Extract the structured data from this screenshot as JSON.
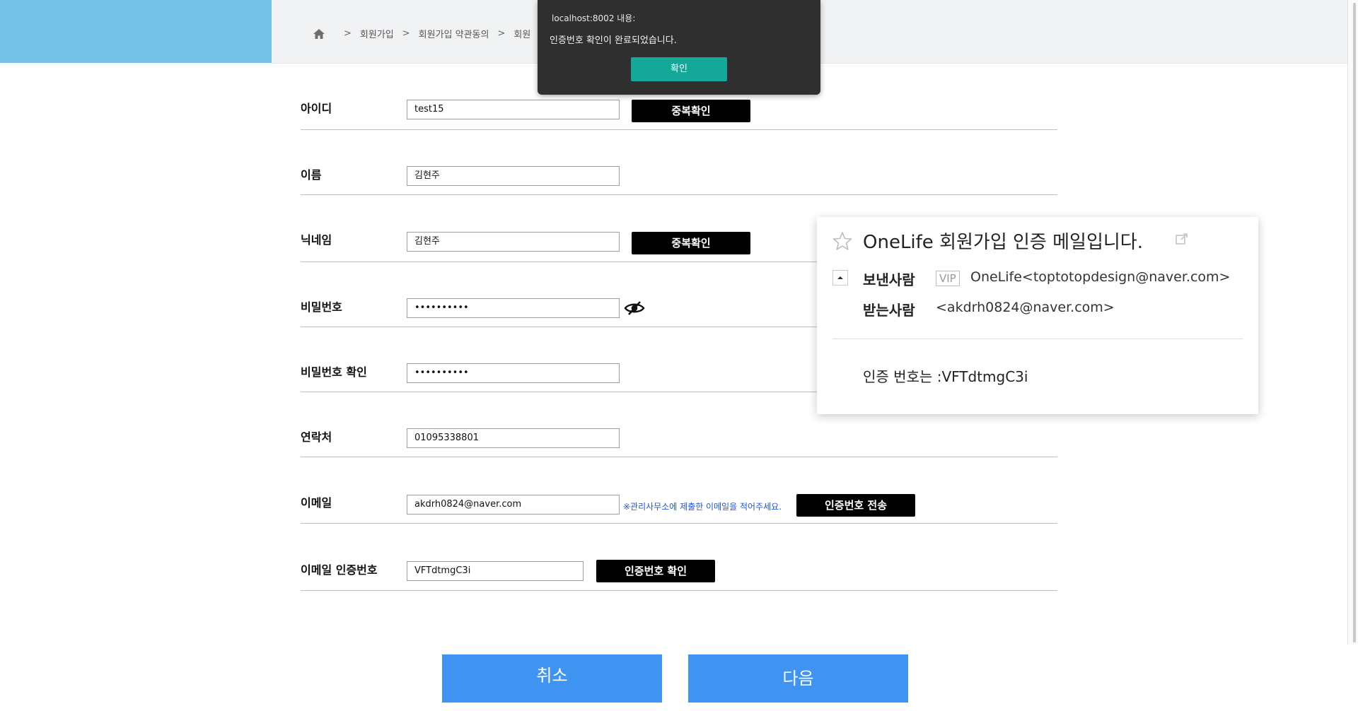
{
  "breadcrumb": {
    "items": [
      "회원가입",
      "회원가입 약관동의",
      "회원"
    ],
    "separator": ">"
  },
  "alert": {
    "origin": "localhost:8002 내용:",
    "message": "인증번호 확인이 완료되었습니다.",
    "ok_label": "확인"
  },
  "form": {
    "id": {
      "label": "아이디",
      "value": "test15",
      "button": "중복확인"
    },
    "name": {
      "label": "이름",
      "value": "김현주"
    },
    "nickname": {
      "label": "닉네임",
      "value": "김현주",
      "button": "중복확인"
    },
    "password": {
      "label": "비밀번호",
      "value": "••••••••••"
    },
    "password_confirm": {
      "label": "비밀번호 확인",
      "value": "••••••••••"
    },
    "phone": {
      "label": "연락처",
      "value": "01095338801"
    },
    "email": {
      "label": "이메일",
      "value": "akdrh0824@naver.com",
      "hint": "※관리사무소에 제출한 이메일을 적어주세요.",
      "button": "인증번호 전송"
    },
    "email_code": {
      "label": "이메일 인증번호",
      "value": "VFTdtmgC3i",
      "button": "인증번호 확인"
    }
  },
  "actions": {
    "cancel": "취소",
    "next": "다음"
  },
  "mail": {
    "title": "OneLife 회원가입 인증 메일입니다.",
    "sender_label": "보낸사람",
    "vip": "VIP",
    "sender": "OneLife<toptotopdesign@naver.com>",
    "recipient_label": "받는사람",
    "recipient": "<akdrh0824@naver.com>",
    "body": "인증 번호는 :VFTdtmgC3i"
  },
  "colors": {
    "header_blue": "#74c3e6",
    "primary_button": "#4094f1",
    "alert_ok": "#15a79a",
    "hint_text": "#2157d6"
  }
}
